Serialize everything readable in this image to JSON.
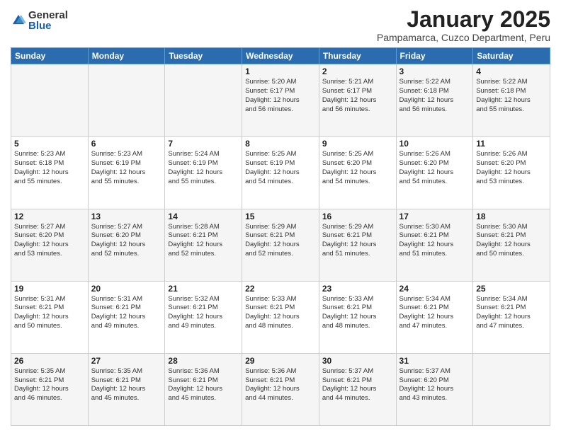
{
  "logo": {
    "general": "General",
    "blue": "Blue"
  },
  "header": {
    "title": "January 2025",
    "subtitle": "Pampamarca, Cuzco Department, Peru"
  },
  "weekdays": [
    "Sunday",
    "Monday",
    "Tuesday",
    "Wednesday",
    "Thursday",
    "Friday",
    "Saturday"
  ],
  "weeks": [
    [
      {
        "day": "",
        "info": ""
      },
      {
        "day": "",
        "info": ""
      },
      {
        "day": "",
        "info": ""
      },
      {
        "day": "1",
        "info": "Sunrise: 5:20 AM\nSunset: 6:17 PM\nDaylight: 12 hours\nand 56 minutes."
      },
      {
        "day": "2",
        "info": "Sunrise: 5:21 AM\nSunset: 6:17 PM\nDaylight: 12 hours\nand 56 minutes."
      },
      {
        "day": "3",
        "info": "Sunrise: 5:22 AM\nSunset: 6:18 PM\nDaylight: 12 hours\nand 56 minutes."
      },
      {
        "day": "4",
        "info": "Sunrise: 5:22 AM\nSunset: 6:18 PM\nDaylight: 12 hours\nand 55 minutes."
      }
    ],
    [
      {
        "day": "5",
        "info": "Sunrise: 5:23 AM\nSunset: 6:18 PM\nDaylight: 12 hours\nand 55 minutes."
      },
      {
        "day": "6",
        "info": "Sunrise: 5:23 AM\nSunset: 6:19 PM\nDaylight: 12 hours\nand 55 minutes."
      },
      {
        "day": "7",
        "info": "Sunrise: 5:24 AM\nSunset: 6:19 PM\nDaylight: 12 hours\nand 55 minutes."
      },
      {
        "day": "8",
        "info": "Sunrise: 5:25 AM\nSunset: 6:19 PM\nDaylight: 12 hours\nand 54 minutes."
      },
      {
        "day": "9",
        "info": "Sunrise: 5:25 AM\nSunset: 6:20 PM\nDaylight: 12 hours\nand 54 minutes."
      },
      {
        "day": "10",
        "info": "Sunrise: 5:26 AM\nSunset: 6:20 PM\nDaylight: 12 hours\nand 54 minutes."
      },
      {
        "day": "11",
        "info": "Sunrise: 5:26 AM\nSunset: 6:20 PM\nDaylight: 12 hours\nand 53 minutes."
      }
    ],
    [
      {
        "day": "12",
        "info": "Sunrise: 5:27 AM\nSunset: 6:20 PM\nDaylight: 12 hours\nand 53 minutes."
      },
      {
        "day": "13",
        "info": "Sunrise: 5:27 AM\nSunset: 6:20 PM\nDaylight: 12 hours\nand 52 minutes."
      },
      {
        "day": "14",
        "info": "Sunrise: 5:28 AM\nSunset: 6:21 PM\nDaylight: 12 hours\nand 52 minutes."
      },
      {
        "day": "15",
        "info": "Sunrise: 5:29 AM\nSunset: 6:21 PM\nDaylight: 12 hours\nand 52 minutes."
      },
      {
        "day": "16",
        "info": "Sunrise: 5:29 AM\nSunset: 6:21 PM\nDaylight: 12 hours\nand 51 minutes."
      },
      {
        "day": "17",
        "info": "Sunrise: 5:30 AM\nSunset: 6:21 PM\nDaylight: 12 hours\nand 51 minutes."
      },
      {
        "day": "18",
        "info": "Sunrise: 5:30 AM\nSunset: 6:21 PM\nDaylight: 12 hours\nand 50 minutes."
      }
    ],
    [
      {
        "day": "19",
        "info": "Sunrise: 5:31 AM\nSunset: 6:21 PM\nDaylight: 12 hours\nand 50 minutes."
      },
      {
        "day": "20",
        "info": "Sunrise: 5:31 AM\nSunset: 6:21 PM\nDaylight: 12 hours\nand 49 minutes."
      },
      {
        "day": "21",
        "info": "Sunrise: 5:32 AM\nSunset: 6:21 PM\nDaylight: 12 hours\nand 49 minutes."
      },
      {
        "day": "22",
        "info": "Sunrise: 5:33 AM\nSunset: 6:21 PM\nDaylight: 12 hours\nand 48 minutes."
      },
      {
        "day": "23",
        "info": "Sunrise: 5:33 AM\nSunset: 6:21 PM\nDaylight: 12 hours\nand 48 minutes."
      },
      {
        "day": "24",
        "info": "Sunrise: 5:34 AM\nSunset: 6:21 PM\nDaylight: 12 hours\nand 47 minutes."
      },
      {
        "day": "25",
        "info": "Sunrise: 5:34 AM\nSunset: 6:21 PM\nDaylight: 12 hours\nand 47 minutes."
      }
    ],
    [
      {
        "day": "26",
        "info": "Sunrise: 5:35 AM\nSunset: 6:21 PM\nDaylight: 12 hours\nand 46 minutes."
      },
      {
        "day": "27",
        "info": "Sunrise: 5:35 AM\nSunset: 6:21 PM\nDaylight: 12 hours\nand 45 minutes."
      },
      {
        "day": "28",
        "info": "Sunrise: 5:36 AM\nSunset: 6:21 PM\nDaylight: 12 hours\nand 45 minutes."
      },
      {
        "day": "29",
        "info": "Sunrise: 5:36 AM\nSunset: 6:21 PM\nDaylight: 12 hours\nand 44 minutes."
      },
      {
        "day": "30",
        "info": "Sunrise: 5:37 AM\nSunset: 6:21 PM\nDaylight: 12 hours\nand 44 minutes."
      },
      {
        "day": "31",
        "info": "Sunrise: 5:37 AM\nSunset: 6:20 PM\nDaylight: 12 hours\nand 43 minutes."
      },
      {
        "day": "",
        "info": ""
      }
    ]
  ]
}
